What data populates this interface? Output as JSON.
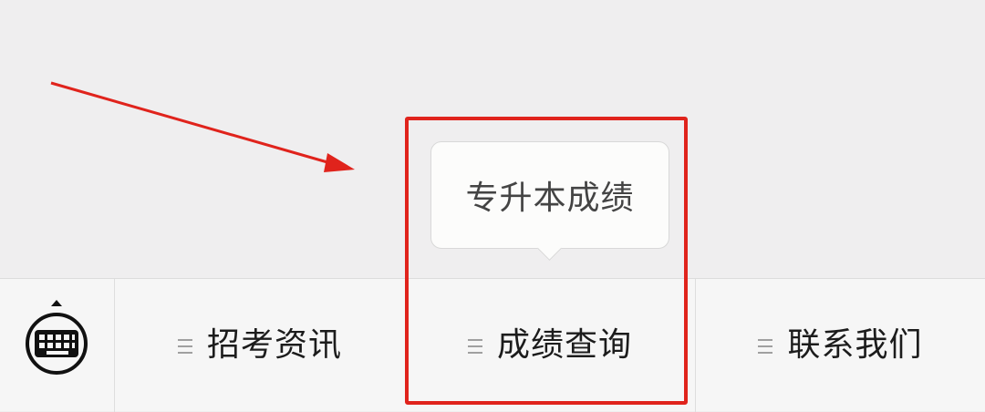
{
  "menu": {
    "items": [
      {
        "label": "招考资讯",
        "icon": "list-icon"
      },
      {
        "label": "成绩查询",
        "icon": "list-icon"
      },
      {
        "label": "联系我们",
        "icon": "list-icon"
      }
    ],
    "keyboard_icon": "keyboard-icon"
  },
  "submenu": {
    "items": [
      {
        "label": "专升本成绩"
      }
    ]
  },
  "annotation": {
    "highlight_color": "#e0231c",
    "arrow_color": "#e0231c"
  },
  "colors": {
    "background": "#efeeef",
    "menu_bar": "#f6f6f6",
    "text": "#1c1c1c"
  }
}
